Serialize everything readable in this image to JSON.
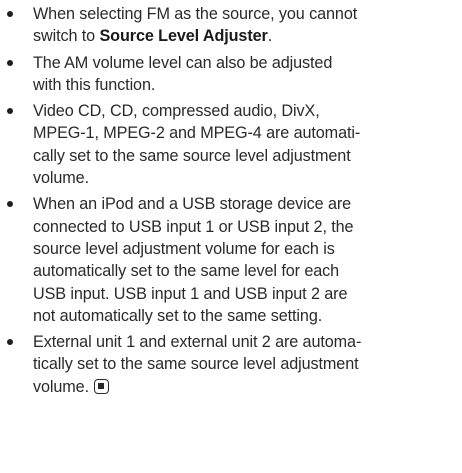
{
  "notes": [
    {
      "lines": [
        {
          "text": "When selecting FM as the source, you cannot"
        },
        {
          "text": "switch to ",
          "emph": "Source Level Adjuster",
          "suffix": "."
        }
      ]
    },
    {
      "lines": [
        {
          "text": "The AM volume level can also be adjusted"
        },
        {
          "text": "with this function."
        }
      ]
    },
    {
      "lines": [
        {
          "text": "Video CD, CD, compressed audio, DivX,"
        },
        {
          "text": "MPEG-1, MPEG-2 and MPEG-4 are automati-"
        },
        {
          "text": "cally set to the same source level adjustment"
        },
        {
          "text": "volume."
        }
      ]
    },
    {
      "lines": [
        {
          "text": "When an iPod and a USB storage device are"
        },
        {
          "text": "connected to USB input 1 or USB input 2, the"
        },
        {
          "text": "source level adjustment volume for each is"
        },
        {
          "text": "automatically set to the same level for each"
        },
        {
          "text": "USB input. USB input 1 and USB input 2 are"
        },
        {
          "text": "not automatically set to the same setting."
        }
      ]
    },
    {
      "lines": [
        {
          "text": "External unit 1 and external unit 2 are automa-"
        },
        {
          "text": "tically set to the same source level adjustment"
        },
        {
          "text": "volume.",
          "end_mark": "end-of-section-icon"
        }
      ]
    }
  ]
}
